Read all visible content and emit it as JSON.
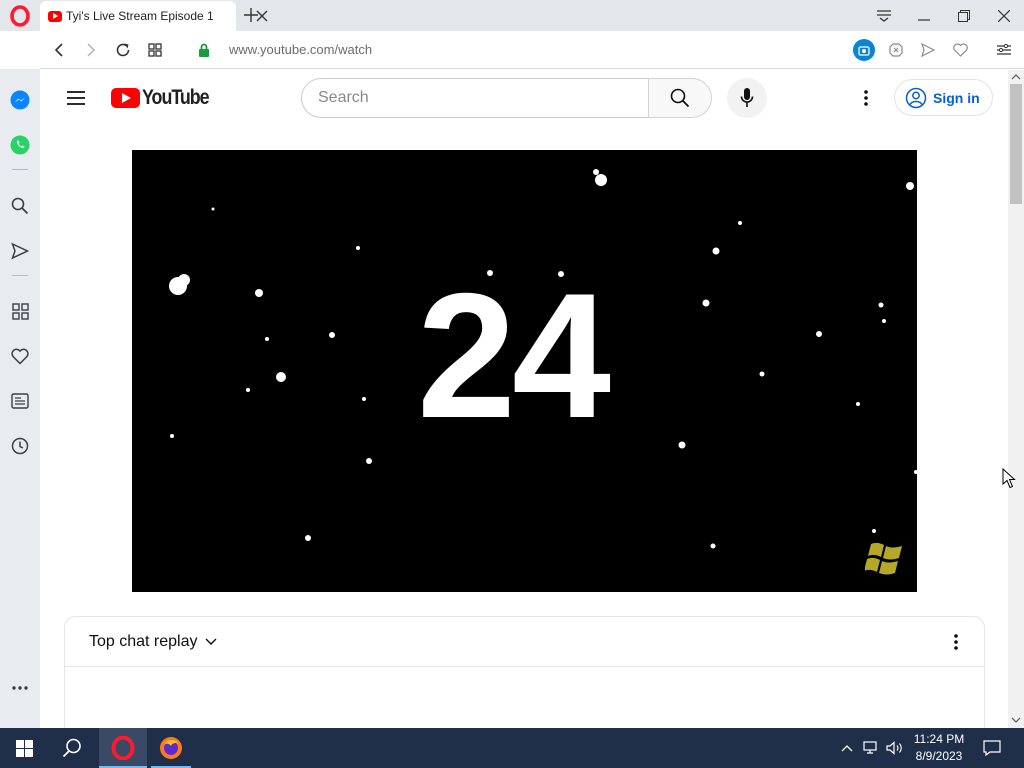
{
  "browser": {
    "tab": {
      "title": "Tyi's Live Stream Episode 1"
    },
    "url": {
      "host": "www.youtube.com",
      "path": "/watch"
    }
  },
  "youtube": {
    "logo_text": "YouTube",
    "search": {
      "placeholder": "Search"
    },
    "sign_in_label": "Sign in"
  },
  "video": {
    "countdown": "24"
  },
  "chat": {
    "title": "Top chat replay"
  },
  "taskbar": {
    "time": "11:24 PM",
    "date": "8/9/2023"
  },
  "colors": {
    "opera_red": "#ff1b2d",
    "youtube_red": "#ff0000",
    "link_blue": "#065fd4",
    "taskbar": "#1f2f4a"
  }
}
